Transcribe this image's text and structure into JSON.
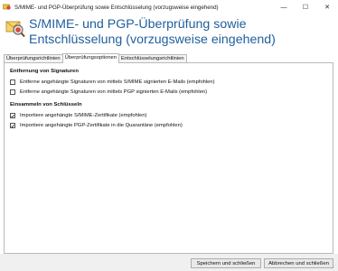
{
  "window": {
    "title": "S/MIME- und PGP-Überprüfung sowie Entschlüsselung (vorzugsweise eingehend)",
    "minimize": "—",
    "maximize": "☐",
    "close": "✕"
  },
  "header": {
    "title": "S/MIME- und PGP-Überprüfung sowie Entschlüsselung (vorzugsweise eingehend)"
  },
  "tabs": [
    {
      "label": "Überprüfungsrichtlinien",
      "active": false
    },
    {
      "label": "Überprüfungsoptionen",
      "active": true
    },
    {
      "label": "Entschlüsselungsrichtlinien",
      "active": false
    }
  ],
  "sections": [
    {
      "title": "Entfernung von Signaturen",
      "options": [
        {
          "label": "Entferne angehängte Signaturen von mittels S/MIME signierten E-Mails (empfohlen)",
          "checked": false
        },
        {
          "label": "Entferne angehängte Signaturen von mittels PGP signierten E-Mails (empfohlen)",
          "checked": false
        }
      ]
    },
    {
      "title": "Einsammeln von Schlüsseln",
      "options": [
        {
          "label": "Importiere angehängte S/MIME-Zertifikate (empfohlen)",
          "checked": true
        },
        {
          "label": "Importiere angehängte PGP-Zertifikate in die Quarantäne (empfohlen)",
          "checked": true
        }
      ]
    }
  ],
  "footer": {
    "save_label": "Speichern und schließen",
    "cancel_label": "Abbrechen und schließen"
  },
  "colors": {
    "header_text": "#1f5f9e",
    "check_mark": "#1b1b1b"
  }
}
